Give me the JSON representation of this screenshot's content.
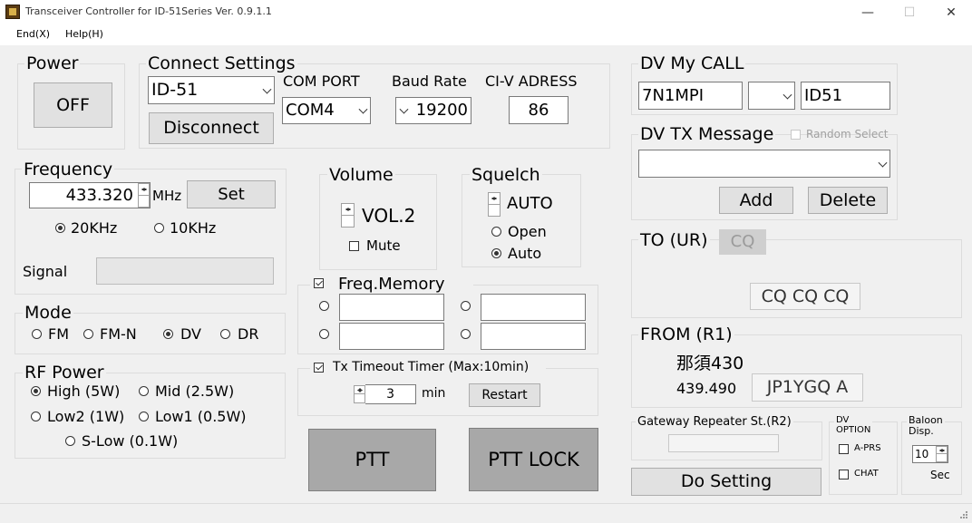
{
  "window": {
    "title": "Transceiver Controller for ID-51Series  Ver. 0.9.1.1",
    "minimize_glyph": "—",
    "maximize_glyph": "☐",
    "close_glyph": "✕",
    "icon": "app-icon"
  },
  "menu": {
    "end": "End(X)",
    "help": "Help(H)"
  },
  "power": {
    "label": "Power",
    "button": "OFF"
  },
  "connect": {
    "label": "Connect Settings",
    "model": "ID-51",
    "disconnect": "Disconnect",
    "com_port_label": "COM PORT",
    "com_port_value": "COM4",
    "baud_rate_label": "Baud Rate",
    "baud_rate_value": "19200",
    "civ_label": "CI-V ADRESS",
    "civ_value": "86"
  },
  "frequency": {
    "label": "Frequency",
    "value": "433.320",
    "unit": "MHz",
    "set_button": "Set",
    "step_20": "20KHz",
    "step_10": "10KHz",
    "step_selected": "20KHz",
    "signal_label": "Signal",
    "signal_level": 0
  },
  "volume": {
    "label": "Volume",
    "value": "VOL.2",
    "mute": "Mute",
    "mute_checked": false
  },
  "squelch": {
    "label": "Squelch",
    "value": "AUTO",
    "open": "Open",
    "auto": "Auto",
    "selected": "Auto"
  },
  "mode": {
    "label": "Mode",
    "options": [
      "FM",
      "FM-N",
      "DV",
      "DR"
    ],
    "selected": "DV"
  },
  "rf_power": {
    "label": "RF Power",
    "high": "High (5W)",
    "mid": "Mid (2.5W)",
    "low2": "Low2 (1W)",
    "low1": "Low1 (0.5W)",
    "slow": "S-Low (0.1W)",
    "selected": "High (5W)"
  },
  "freq_memory": {
    "label": "Freq.Memory",
    "checked": true,
    "slots": [
      "",
      "",
      "",
      ""
    ]
  },
  "tx_timeout": {
    "label": "Tx Timeout Timer (Max:10min)",
    "checked": true,
    "value": "3",
    "unit": "min",
    "restart": "Restart"
  },
  "ptt": {
    "ptt": "PTT",
    "lock": "PTT LOCK"
  },
  "dv_my_call": {
    "label": "DV My CALL",
    "callsign": "7N1MPI",
    "suffix_select": "",
    "memo": "ID51"
  },
  "dv_tx_message": {
    "label": "DV TX Message",
    "random_select": "Random Select",
    "random_checked": false,
    "message": "",
    "add": "Add",
    "delete": "Delete"
  },
  "to_ur": {
    "label": "TO (UR)",
    "badge": "CQ",
    "value": "CQ CQ CQ"
  },
  "from_r1": {
    "label": "FROM (R1)",
    "name": "那須430",
    "freq": "439.490",
    "call": "JP1YGQ A"
  },
  "gateway": {
    "label": "Gateway Repeater St.(R2)",
    "value": ""
  },
  "dv_option": {
    "label_1": "DV",
    "label_2": "OPTION",
    "aprs": "A-PRS",
    "chat": "CHAT",
    "aprs_checked": false,
    "chat_checked": false
  },
  "balloon": {
    "label_1": "Baloon",
    "label_2": "Disp.",
    "value": "10",
    "unit": "Sec"
  },
  "do_setting": "Do Setting"
}
